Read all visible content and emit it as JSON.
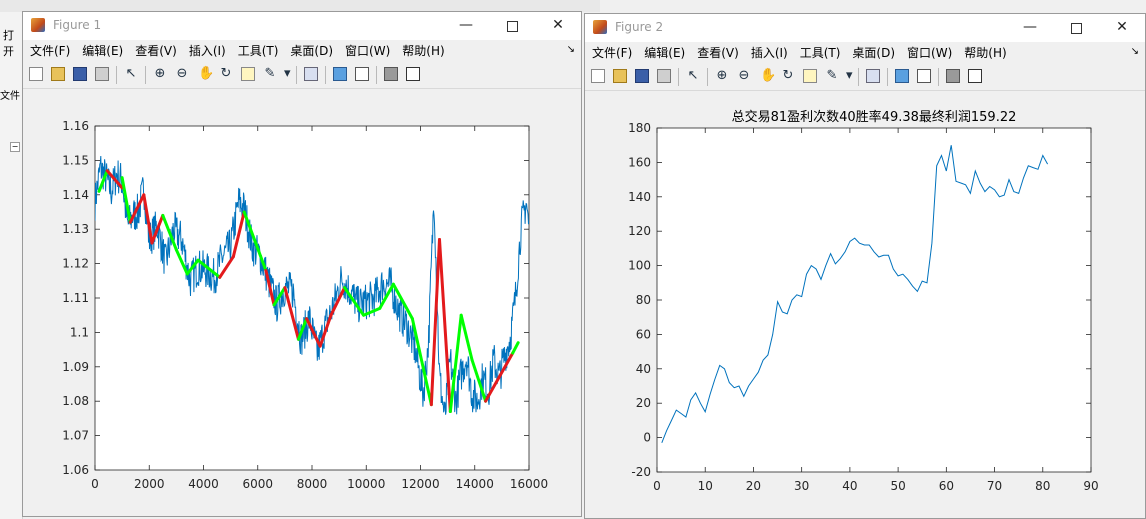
{
  "figure1": {
    "title": "Figure 1",
    "menu": [
      "文件(F)",
      "编辑(E)",
      "查看(V)",
      "插入(I)",
      "工具(T)",
      "桌面(D)",
      "窗口(W)",
      "帮助(H)"
    ],
    "toolbar_icons": [
      "new-figure-icon",
      "open-file-icon",
      "save-icon",
      "print-icon",
      "pointer-icon",
      "zoom-in-icon",
      "zoom-out-icon",
      "pan-icon",
      "rotate-icon",
      "data-cursor-icon",
      "brush-icon",
      "brush-dropdown-icon",
      "link-plot-icon",
      "colorbar-icon",
      "legend-icon",
      "hide-plot-tools-icon",
      "show-plot-tools-icon"
    ]
  },
  "figure2": {
    "title": "Figure 2",
    "menu": [
      "文件(F)",
      "编辑(E)",
      "查看(V)",
      "插入(I)",
      "工具(T)",
      "桌面(D)",
      "窗口(W)",
      "帮助(H)"
    ]
  },
  "background": {
    "label_open": "打开",
    "label_file": "文件"
  },
  "colors": {
    "price_line": "#0072bd",
    "win_trade": "#00ff00",
    "loss_trade": "#e31a1c",
    "equity_line": "#0072bd"
  },
  "chart_data": [
    {
      "type": "line",
      "title": "",
      "xlabel": "",
      "ylabel": "",
      "xlim": [
        0,
        16000
      ],
      "ylim": [
        1.06,
        1.16
      ],
      "xticks": [
        0,
        2000,
        4000,
        6000,
        8000,
        10000,
        12000,
        14000,
        16000
      ],
      "yticks": [
        1.06,
        1.07,
        1.08,
        1.09,
        1.1,
        1.11,
        1.12,
        1.13,
        1.14,
        1.15,
        1.16
      ],
      "ytick_labels": [
        "1.06",
        "1.07",
        "1.08",
        "1.09",
        "1.1",
        "1.11",
        "1.12",
        "1.13",
        "1.14",
        "1.15",
        "1.16"
      ],
      "grid": false,
      "price_series": {
        "x": [
          0,
          200,
          400,
          600,
          800,
          1000,
          1200,
          1400,
          1600,
          1800,
          2000,
          2300,
          2600,
          2900,
          3200,
          3500,
          3800,
          4100,
          4400,
          4700,
          5000,
          5300,
          5500,
          5800,
          6100,
          6400,
          6700,
          7000,
          7300,
          7600,
          7900,
          8200,
          8500,
          8800,
          9100,
          9400,
          9700,
          10000,
          10300,
          10600,
          10900,
          11200,
          11500,
          11800,
          12100,
          12300,
          12500,
          12700,
          12900,
          13100,
          13300,
          13500,
          13700,
          13900,
          14100,
          14300,
          14500,
          14700,
          14900,
          15100,
          15300,
          15500,
          15700,
          15900,
          16000
        ],
        "y": [
          1.138,
          1.148,
          1.145,
          1.141,
          1.146,
          1.144,
          1.131,
          1.134,
          1.135,
          1.142,
          1.127,
          1.131,
          1.12,
          1.13,
          1.127,
          1.115,
          1.119,
          1.118,
          1.116,
          1.122,
          1.125,
          1.138,
          1.136,
          1.125,
          1.122,
          1.115,
          1.108,
          1.113,
          1.112,
          1.098,
          1.104,
          1.094,
          1.102,
          1.108,
          1.116,
          1.112,
          1.108,
          1.109,
          1.11,
          1.114,
          1.114,
          1.106,
          1.102,
          1.095,
          1.082,
          1.098,
          1.14,
          1.087,
          1.075,
          1.092,
          1.08,
          1.088,
          1.093,
          1.082,
          1.08,
          1.087,
          1.083,
          1.092,
          1.087,
          1.093,
          1.098,
          1.11,
          1.13,
          1.138,
          1.13
        ]
      },
      "trades": [
        {
          "x": [
            150,
            450
          ],
          "y": [
            1.141,
            1.147
          ],
          "result": "win"
        },
        {
          "x": [
            450,
            1000
          ],
          "y": [
            1.147,
            1.142
          ],
          "result": "loss"
        },
        {
          "x": [
            1000,
            1300
          ],
          "y": [
            1.145,
            1.132
          ],
          "result": "win"
        },
        {
          "x": [
            1300,
            1800
          ],
          "y": [
            1.132,
            1.14
          ],
          "result": "loss"
        },
        {
          "x": [
            1800,
            2100
          ],
          "y": [
            1.14,
            1.126
          ],
          "result": "loss"
        },
        {
          "x": [
            2100,
            2500
          ],
          "y": [
            1.126,
            1.134
          ],
          "result": "loss"
        },
        {
          "x": [
            2500,
            3000
          ],
          "y": [
            1.134,
            1.124
          ],
          "result": "win"
        },
        {
          "x": [
            3000,
            3400
          ],
          "y": [
            1.124,
            1.117
          ],
          "result": "win"
        },
        {
          "x": [
            3400,
            3800
          ],
          "y": [
            1.117,
            1.121
          ],
          "result": "win"
        },
        {
          "x": [
            3800,
            4600
          ],
          "y": [
            1.121,
            1.116
          ],
          "result": "win"
        },
        {
          "x": [
            4600,
            5100
          ],
          "y": [
            1.116,
            1.122
          ],
          "result": "loss"
        },
        {
          "x": [
            5100,
            5500
          ],
          "y": [
            1.122,
            1.135
          ],
          "result": "loss"
        },
        {
          "x": [
            5500,
            6300
          ],
          "y": [
            1.135,
            1.118
          ],
          "result": "win"
        },
        {
          "x": [
            6300,
            6600
          ],
          "y": [
            1.118,
            1.108
          ],
          "result": "loss"
        },
        {
          "x": [
            6600,
            7000
          ],
          "y": [
            1.108,
            1.113
          ],
          "result": "win"
        },
        {
          "x": [
            7000,
            7500
          ],
          "y": [
            1.113,
            1.098
          ],
          "result": "loss"
        },
        {
          "x": [
            7500,
            7800
          ],
          "y": [
            1.098,
            1.104
          ],
          "result": "win"
        },
        {
          "x": [
            7800,
            8300
          ],
          "y": [
            1.104,
            1.096
          ],
          "result": "loss"
        },
        {
          "x": [
            8300,
            8700
          ],
          "y": [
            1.096,
            1.105
          ],
          "result": "loss"
        },
        {
          "x": [
            8700,
            9200
          ],
          "y": [
            1.105,
            1.113
          ],
          "result": "loss"
        },
        {
          "x": [
            9200,
            9900
          ],
          "y": [
            1.113,
            1.105
          ],
          "result": "win"
        },
        {
          "x": [
            9900,
            10500
          ],
          "y": [
            1.105,
            1.107
          ],
          "result": "win"
        },
        {
          "x": [
            10500,
            11000
          ],
          "y": [
            1.107,
            1.114
          ],
          "result": "win"
        },
        {
          "x": [
            11000,
            11700
          ],
          "y": [
            1.114,
            1.104
          ],
          "result": "win"
        },
        {
          "x": [
            11700,
            12400
          ],
          "y": [
            1.104,
            1.079
          ],
          "result": "win"
        },
        {
          "x": [
            12400,
            12700
          ],
          "y": [
            1.079,
            1.127
          ],
          "result": "loss"
        },
        {
          "x": [
            12700,
            13100
          ],
          "y": [
            1.127,
            1.077
          ],
          "result": "loss"
        },
        {
          "x": [
            13100,
            13500
          ],
          "y": [
            1.077,
            1.105
          ],
          "result": "win"
        },
        {
          "x": [
            13500,
            13900
          ],
          "y": [
            1.105,
            1.092
          ],
          "result": "win"
        },
        {
          "x": [
            13900,
            14400
          ],
          "y": [
            1.092,
            1.08
          ],
          "result": "win"
        },
        {
          "x": [
            14400,
            14900
          ],
          "y": [
            1.08,
            1.087
          ],
          "result": "loss"
        },
        {
          "x": [
            14900,
            15400
          ],
          "y": [
            1.087,
            1.094
          ],
          "result": "loss"
        },
        {
          "x": [
            15400,
            15600
          ],
          "y": [
            1.094,
            1.097
          ],
          "result": "win"
        }
      ]
    },
    {
      "type": "line",
      "title": "总交易81盈利次数40胜率49.38最终利润159.22",
      "xlabel": "",
      "ylabel": "",
      "xlim": [
        0,
        90
      ],
      "ylim": [
        -20,
        180
      ],
      "xticks": [
        0,
        10,
        20,
        30,
        40,
        50,
        60,
        70,
        80,
        90
      ],
      "yticks": [
        -20,
        0,
        20,
        40,
        60,
        80,
        100,
        120,
        140,
        160,
        180
      ],
      "grid": false,
      "series": [
        {
          "x": [
            1,
            2,
            3,
            4,
            5,
            6,
            7,
            8,
            9,
            10,
            11,
            12,
            13,
            14,
            15,
            16,
            17,
            18,
            19,
            20,
            21,
            22,
            23,
            24,
            25,
            26,
            27,
            28,
            29,
            30,
            31,
            32,
            33,
            34,
            35,
            36,
            37,
            38,
            39,
            40,
            41,
            42,
            43,
            44,
            45,
            46,
            47,
            48,
            49,
            50,
            51,
            52,
            53,
            54,
            55,
            56,
            57,
            58,
            59,
            60,
            61,
            62,
            63,
            64,
            65,
            66,
            67,
            68,
            69,
            70,
            71,
            72,
            73,
            74,
            75,
            76,
            77,
            78,
            79,
            80,
            81
          ],
          "y": [
            -3,
            4,
            10,
            16,
            14,
            12,
            22,
            26,
            20,
            15,
            25,
            34,
            42,
            40,
            32,
            29,
            30,
            24,
            30,
            34,
            38,
            45,
            48,
            60,
            79,
            73,
            72,
            80,
            83,
            82,
            95,
            100,
            98,
            92,
            100,
            107,
            101,
            104,
            108,
            114,
            116,
            113,
            112,
            112,
            108,
            105,
            106,
            106,
            98,
            94,
            95,
            92,
            88,
            85,
            91,
            90,
            113,
            158,
            164,
            155,
            170,
            149,
            148,
            147,
            142,
            155,
            148,
            143,
            146,
            144,
            140,
            141,
            150,
            143,
            142,
            151,
            158,
            157,
            156,
            164,
            159
          ]
        }
      ]
    }
  ]
}
